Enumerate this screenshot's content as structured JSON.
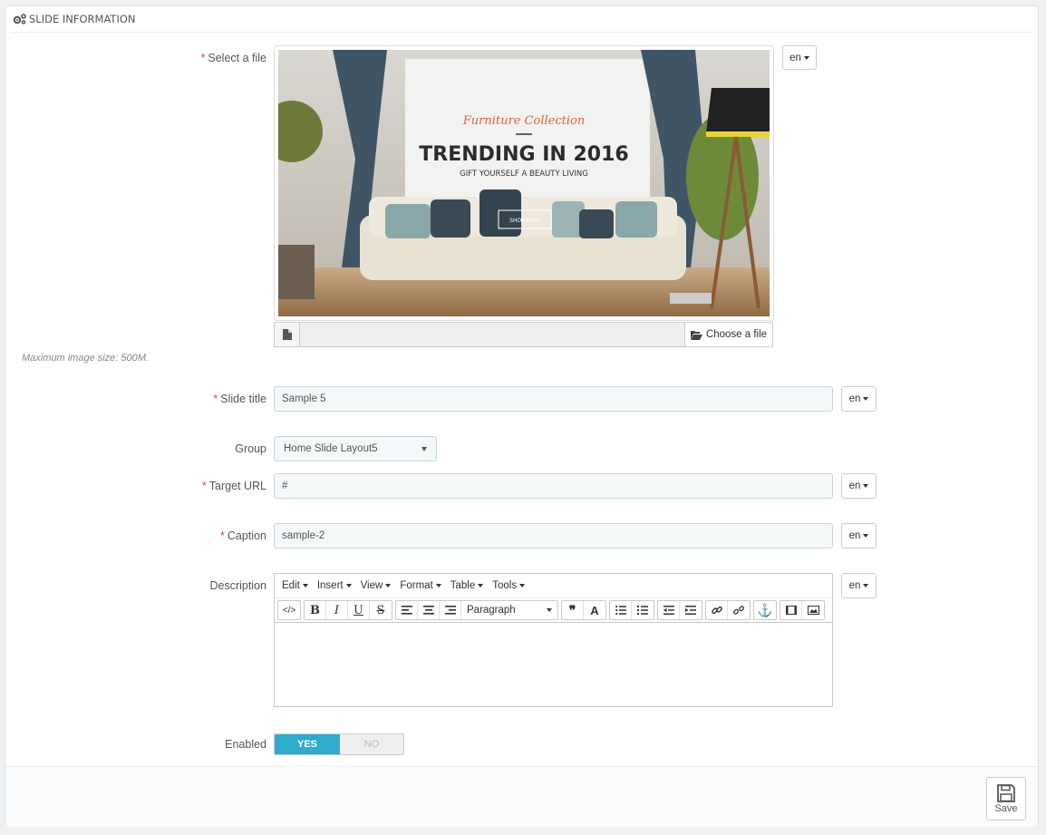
{
  "panel": {
    "title": "Slide information"
  },
  "file": {
    "label": "Select a file",
    "lang": "en",
    "choose_label": "Choose a file",
    "hint": "Maximum image size: 500M.",
    "preview": {
      "tagline": "Furniture Collection",
      "headline": "TRENDING IN 2016",
      "subline": "GIFT YOURSELF A BEAUTY LIVING",
      "button": "SHOP NOW"
    }
  },
  "slide_title": {
    "label": "Slide title",
    "value": "Sample 5",
    "lang": "en"
  },
  "group": {
    "label": "Group",
    "value": "Home Slide Layout5"
  },
  "target_url": {
    "label": "Target URL",
    "value": "#",
    "lang": "en"
  },
  "caption": {
    "label": "Caption",
    "value": "sample-2",
    "lang": "en"
  },
  "description": {
    "label": "Description",
    "lang": "en",
    "menus": [
      "Edit",
      "Insert",
      "View",
      "Format",
      "Table",
      "Tools"
    ],
    "block_format": "Paragraph"
  },
  "enabled": {
    "label": "Enabled",
    "yes": "YES",
    "no": "NO"
  },
  "footer": {
    "save_label": "Save"
  },
  "colors": {
    "accent": "#2eacce",
    "required": "#e23d3d"
  }
}
